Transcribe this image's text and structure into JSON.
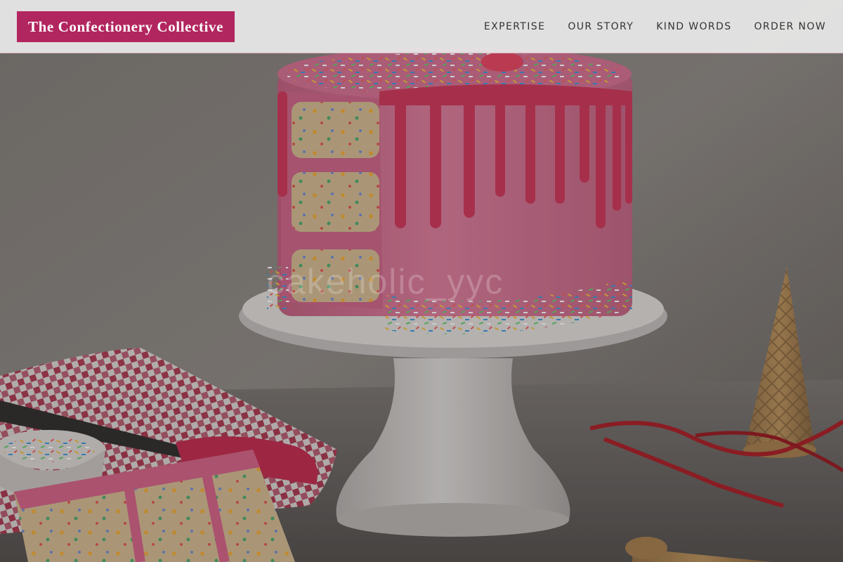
{
  "header": {
    "brand": "The Confectionery Collective",
    "nav": [
      {
        "label": "EXPERTISE"
      },
      {
        "label": "OUR STORY"
      },
      {
        "label": "KIND WORDS"
      },
      {
        "label": "ORDER NOW"
      }
    ]
  },
  "hero": {
    "watermark": "cakeholic_yyc"
  },
  "colors": {
    "brand_bg": "#b2265f",
    "brand_text": "#ffffff",
    "nav_text": "#333333",
    "header_bg": "#e8e8e8",
    "frosting": "#cf6f8e",
    "drip": "#c23455"
  }
}
